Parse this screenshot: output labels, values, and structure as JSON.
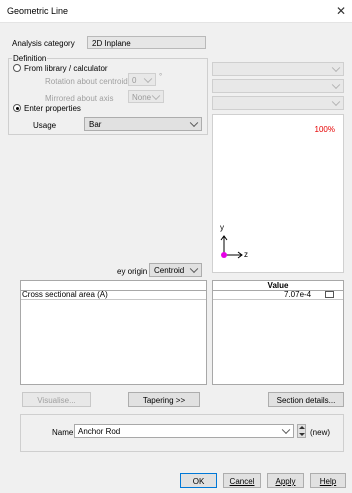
{
  "window": {
    "title": "Geometric Line",
    "close_glyph": "✕"
  },
  "analysis_category": {
    "label": "Analysis category",
    "value": "2D Inplane"
  },
  "definition": {
    "group_label": "Definition",
    "from_library_label": "From library / calculator",
    "rotation_label": "Rotation about centroid",
    "rotation_value": "0",
    "rotation_unit": "°",
    "mirrored_label": "Mirrored about axis",
    "mirrored_value": "None",
    "enter_properties_label": "Enter properties",
    "usage_label": "Usage",
    "usage_value": "Bar"
  },
  "preview": {
    "zoom": "100%",
    "axis_y": "y",
    "axis_z": "z",
    "origin_color": "#e600e6"
  },
  "ey_origin": {
    "label": "ey origin",
    "value": "Centroid"
  },
  "properties_table": {
    "header": "Value",
    "rows": [
      {
        "property": "Cross sectional area (A)",
        "value": "7.07e-4"
      }
    ]
  },
  "buttons": {
    "visualise": "Visualise...",
    "tapering": "Tapering >>",
    "section_details": "Section details...",
    "ok": "OK",
    "cancel": "Cancel",
    "apply": "Apply",
    "help": "Help"
  },
  "name_field": {
    "label": "Name",
    "value": "Anchor Rod",
    "new_label": "(new)"
  }
}
